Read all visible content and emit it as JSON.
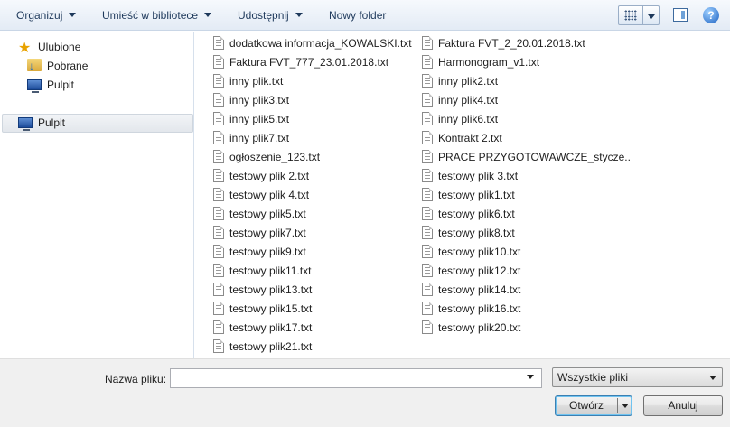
{
  "toolbar": {
    "organize": "Organizuj",
    "library": "Umieść w bibliotece",
    "share": "Udostępnij",
    "new_folder": "Nowy folder",
    "help": "?"
  },
  "nav": {
    "favorites": "Ulubione",
    "downloads": "Pobrane",
    "desktop_fav": "Pulpit",
    "desktop": "Pulpit"
  },
  "files": {
    "col1": [
      "dodatkowa informacja_KOWALSKI.txt",
      "Faktura FVT_777_23.01.2018.txt",
      "inny plik.txt",
      "inny plik3.txt",
      "inny plik5.txt",
      "inny plik7.txt",
      "ogłoszenie_123.txt",
      "testowy plik 2.txt",
      "testowy plik 4.txt",
      "testowy plik5.txt",
      "testowy plik7.txt",
      "testowy plik9.txt",
      "testowy plik11.txt",
      "testowy plik13.txt",
      "testowy plik15.txt",
      "testowy plik17.txt",
      "testowy plik21.txt"
    ],
    "col2": [
      "Faktura FVT_2_20.01.2018.txt",
      "Harmonogram_v1.txt",
      "inny plik2.txt",
      "inny plik4.txt",
      "inny plik6.txt",
      "Kontrakt 2.txt",
      "PRACE PRZYGOTOWAWCZE_stycze...",
      "testowy plik 3.txt",
      "testowy plik1.txt",
      "testowy plik6.txt",
      "testowy plik8.txt",
      "testowy plik10.txt",
      "testowy plik12.txt",
      "testowy plik14.txt",
      "testowy plik16.txt",
      "testowy plik20.txt"
    ]
  },
  "bottom": {
    "filename_label": "Nazwa pliku:",
    "filename_value": "",
    "filter_value": "Wszystkie pliki",
    "open_label": "Otwórz",
    "cancel_label": "Anuluj"
  }
}
